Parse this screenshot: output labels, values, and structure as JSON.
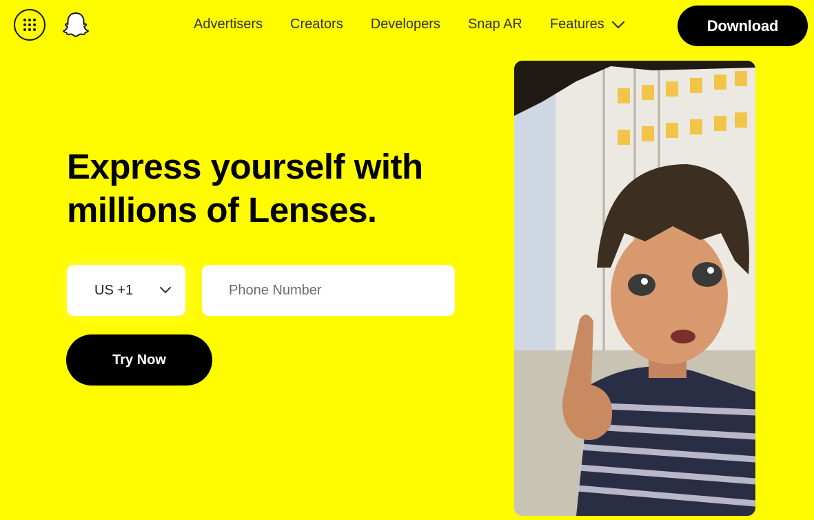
{
  "header": {
    "apps_icon": "grid-dots-icon",
    "logo_icon": "snapchat-ghost-icon",
    "nav": [
      {
        "label": "Advertisers"
      },
      {
        "label": "Creators"
      },
      {
        "label": "Developers"
      },
      {
        "label": "Snap AR"
      },
      {
        "label": "Features",
        "icon": "chevron-down-icon"
      }
    ],
    "download_label": "Download"
  },
  "hero": {
    "title_line1": "Express yourself with",
    "title_line2": "millions of Lenses.",
    "country": {
      "value": "US +1",
      "icon": "chevron-down-icon"
    },
    "phone": {
      "placeholder": "Phone Number",
      "value": ""
    },
    "cta_label": "Try Now"
  },
  "preview": {
    "description_icon": "lens-preview-image"
  },
  "colors": {
    "brand_yellow": "#FFFC00",
    "button_black": "#000000",
    "text_dark": "#16191C"
  }
}
